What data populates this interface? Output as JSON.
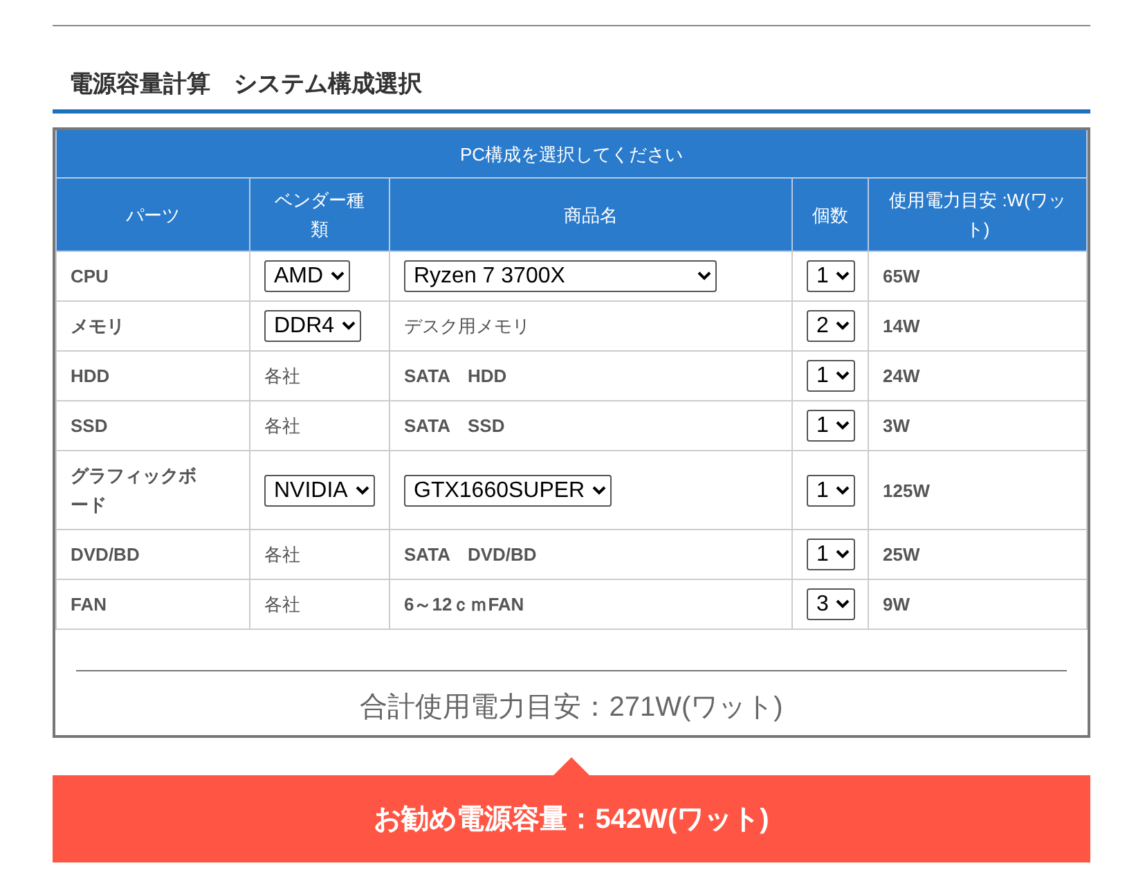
{
  "heading": "電源容量計算　システム構成選択",
  "table": {
    "caption": "PC構成を選択してください",
    "columns": [
      "パーツ",
      "ベンダー種類",
      "商品名",
      "個数",
      "使用電力目安 :W(ワット)"
    ],
    "rows": [
      {
        "part": "CPU",
        "vendor": {
          "kind": "select",
          "value": "AMD"
        },
        "product": {
          "kind": "select",
          "value": "Ryzen 7 3700X"
        },
        "count": "1",
        "watt": "65W"
      },
      {
        "part": "メモリ",
        "vendor": {
          "kind": "select",
          "value": "DDR4"
        },
        "product": {
          "kind": "text",
          "value": "デスク用メモリ"
        },
        "count": "2",
        "watt": "14W"
      },
      {
        "part": "HDD",
        "vendor": {
          "kind": "text",
          "value": "各社"
        },
        "product": {
          "kind": "text",
          "value": "SATA　HDD"
        },
        "count": "1",
        "watt": "24W"
      },
      {
        "part": "SSD",
        "vendor": {
          "kind": "text",
          "value": "各社"
        },
        "product": {
          "kind": "text",
          "value": "SATA　SSD"
        },
        "count": "1",
        "watt": "3W"
      },
      {
        "part": "グラフィックボード",
        "vendor": {
          "kind": "select",
          "value": "NVIDIA"
        },
        "product": {
          "kind": "select",
          "value": "GTX1660SUPER"
        },
        "count": "1",
        "watt": "125W"
      },
      {
        "part": "DVD/BD",
        "vendor": {
          "kind": "text",
          "value": "各社"
        },
        "product": {
          "kind": "text",
          "value": "SATA　DVD/BD"
        },
        "count": "1",
        "watt": "25W"
      },
      {
        "part": "FAN",
        "vendor": {
          "kind": "text",
          "value": "各社"
        },
        "product": {
          "kind": "text",
          "value": "6～12ｃｍFAN"
        },
        "count": "3",
        "watt": "9W"
      }
    ]
  },
  "total": "合計使用電力目安：271W(ワット)",
  "recommended": "お勧め電源容量：542W(ワット)"
}
